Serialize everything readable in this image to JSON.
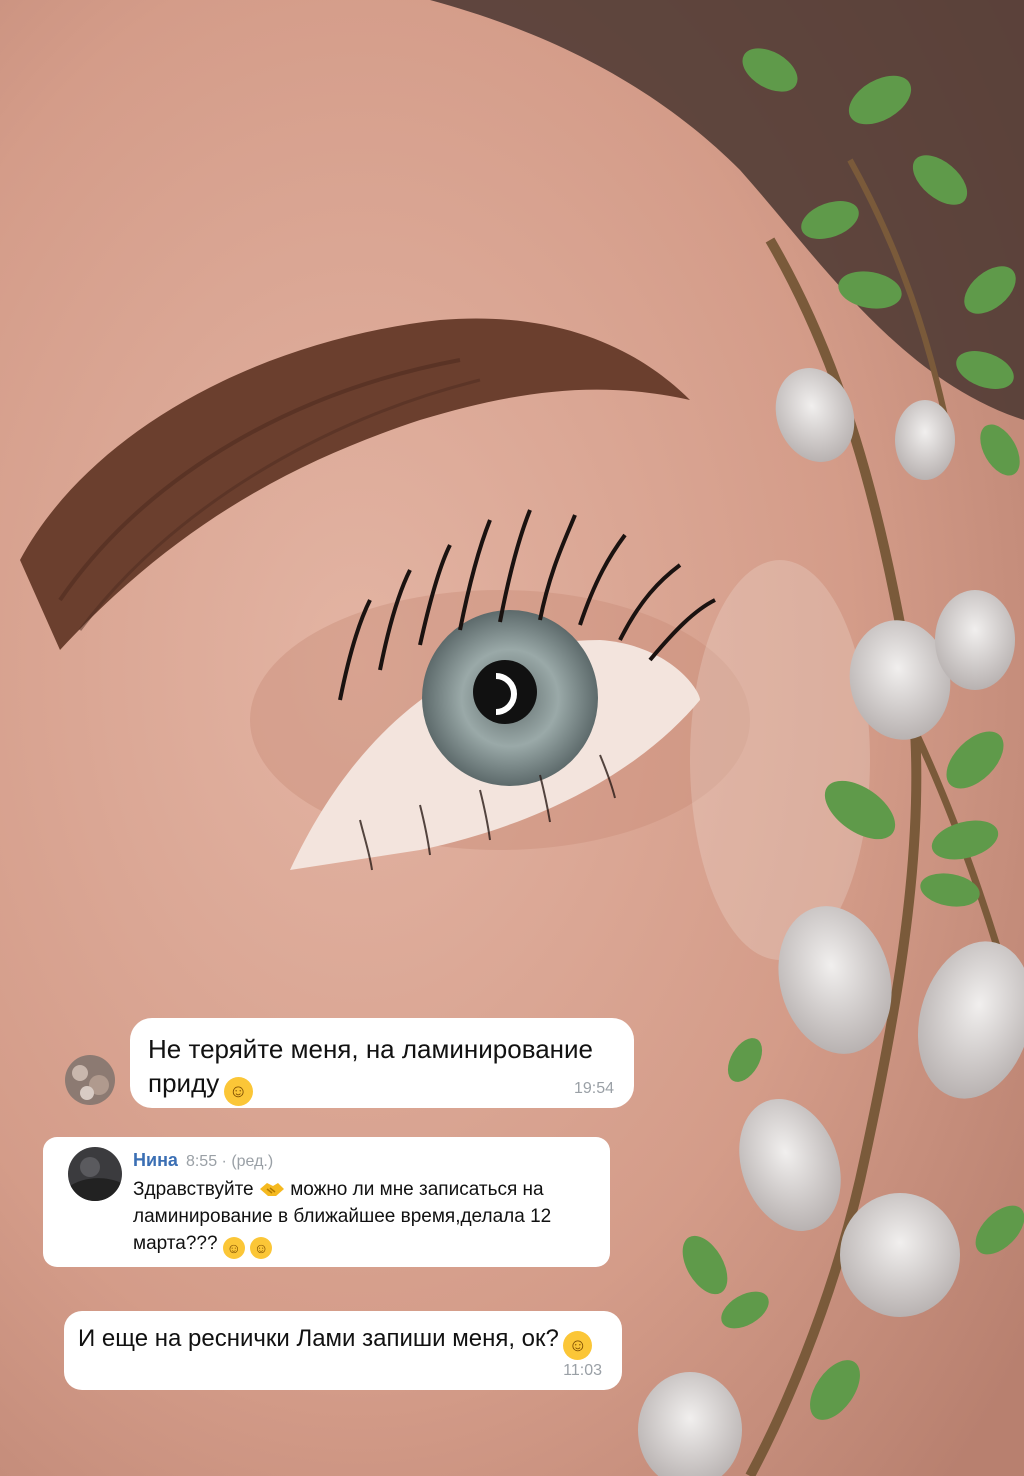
{
  "messages": [
    {
      "text": "Не теряйте меня, на ламинирование приду",
      "emoji": "smile-emoji",
      "time": "19:54"
    },
    {
      "author": "Нина",
      "meta": "8:55 · (ред.)",
      "text_part1": "Здравствуйте",
      "text_part2": "можно ли мне записаться на ламинирование в ближайшее время,делала 12 марта???",
      "emojis": [
        "handshake-emoji",
        "grin-emoji",
        "wink-emoji"
      ]
    },
    {
      "text": "И еще на реснички Лами запиши меня, ок?",
      "emoji": "wink-emoji",
      "time": "11:03"
    }
  ],
  "colors": {
    "skin": "#d9a593",
    "brow": "#6b3f2e",
    "iris": "#8a9a9c",
    "leaf": "#5f9a4a",
    "catkin": "#d8d4d3",
    "name_link": "#3b6fb4"
  }
}
